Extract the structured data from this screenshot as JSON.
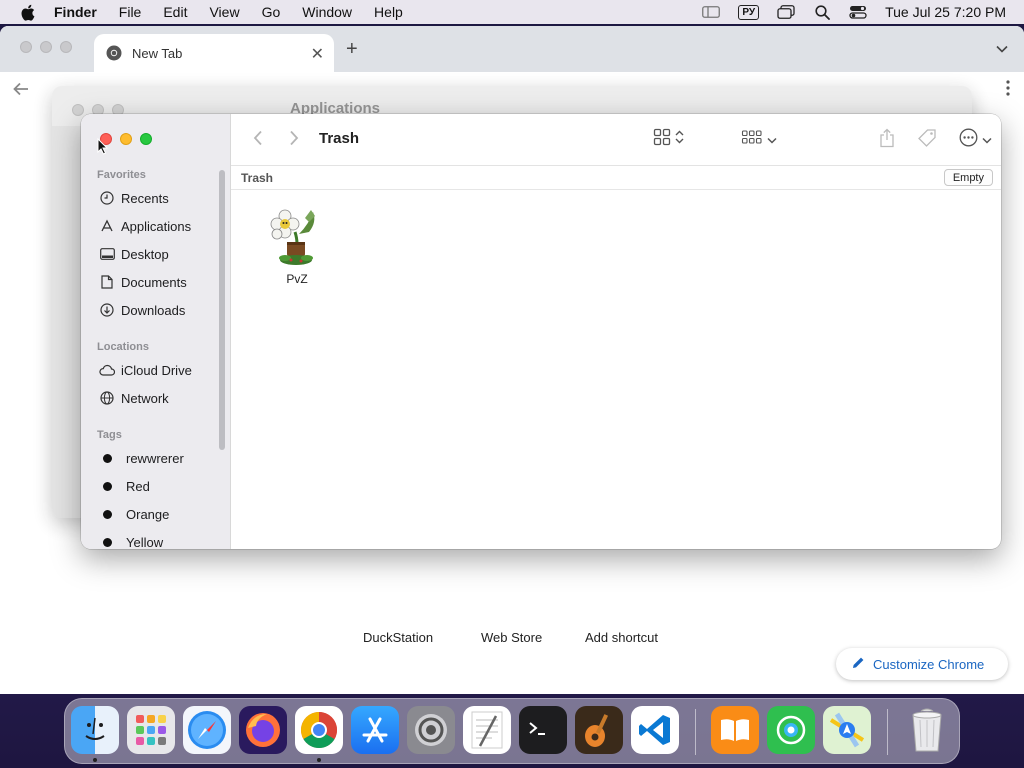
{
  "menubar": {
    "app_name": "Finder",
    "items": [
      "File",
      "Edit",
      "View",
      "Go",
      "Window",
      "Help"
    ],
    "input_source": "РУ",
    "clock": "Tue Jul 25  7:20 PM",
    "icons": [
      "sidebar-icon",
      "input-source-icon",
      "window-icon",
      "spotlight-icon",
      "control-center-icon"
    ]
  },
  "chrome": {
    "tab_title": "New Tab",
    "shortcuts": [
      "DuckStation",
      "Web Store",
      "Add shortcut"
    ],
    "customize_label": "Customize Chrome"
  },
  "finder_back": {
    "title": "Applications"
  },
  "finder": {
    "title": "Trash",
    "path_label": "Trash",
    "empty_label": "Empty",
    "sidebar": {
      "favorites_label": "Favorites",
      "favorites": [
        "Recents",
        "Applications",
        "Desktop",
        "Documents",
        "Downloads"
      ],
      "locations_label": "Locations",
      "locations": [
        "iCloud Drive",
        "Network"
      ],
      "tags_label": "Tags",
      "tags": [
        "rewwrerer",
        "Red",
        "Orange",
        "Yellow"
      ]
    },
    "files": [
      {
        "name": "PvZ",
        "icon": "pvz-app-icon"
      }
    ]
  },
  "dock": {
    "apps": [
      "Finder",
      "Launchpad",
      "Safari",
      "Firefox",
      "Chrome",
      "App Store",
      "System Settings",
      "TextEdit",
      "Terminal",
      "GarageBand",
      "VS Code",
      "Books",
      "Find My",
      "Maps",
      "Trash"
    ]
  },
  "colors": {
    "close": "#fe5f57",
    "minimize": "#febc2e",
    "zoom": "#28c840",
    "accent": "#1a66c2"
  }
}
